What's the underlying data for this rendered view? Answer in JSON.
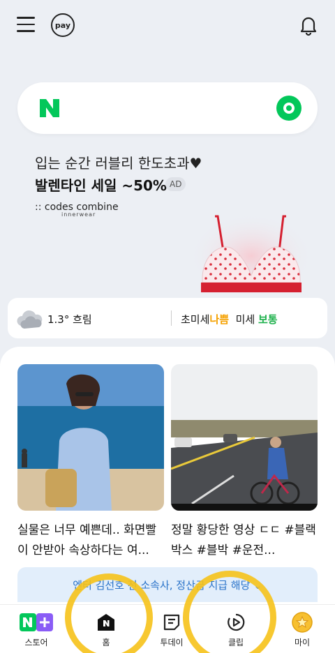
{
  "header": {
    "pay_label": "pay"
  },
  "search": {
    "logo_letter": "N"
  },
  "ad": {
    "line1": "입는 순간 러블리 한도초과♥",
    "line2": "발렌타인 세일 ~50%",
    "badge": "AD",
    "brand_name": ":: codes combine",
    "brand_sub": "innerwear"
  },
  "weather": {
    "temp_condition": "1.3° 흐림",
    "fine_dust_label": "초미세",
    "fine_dust_value": "나쁨",
    "dust_label": "미세",
    "dust_value": "보통",
    "colors": {
      "bad": "#f5a100",
      "normal": "#1fb14d"
    }
  },
  "feed": {
    "cards": [
      {
        "caption": "실물은 너무 예쁜데.. 화면빨이 안받아 속상하다는 여..."
      },
      {
        "caption": "정말 황당한 영상 ㄷㄷ #블랙박스 #블박 #운전..."
      }
    ],
    "banner": "엔터 김선호 전 소속사, 정산금 지급 해당 ⌄"
  },
  "tabbar": {
    "tabs": [
      {
        "label": "스토어",
        "icon": "store-icon"
      },
      {
        "label": "홈",
        "icon": "home-icon"
      },
      {
        "label": "투데이",
        "icon": "today-icon"
      },
      {
        "label": "클립",
        "icon": "clip-icon"
      },
      {
        "label": "마이",
        "icon": "my-icon"
      }
    ]
  }
}
